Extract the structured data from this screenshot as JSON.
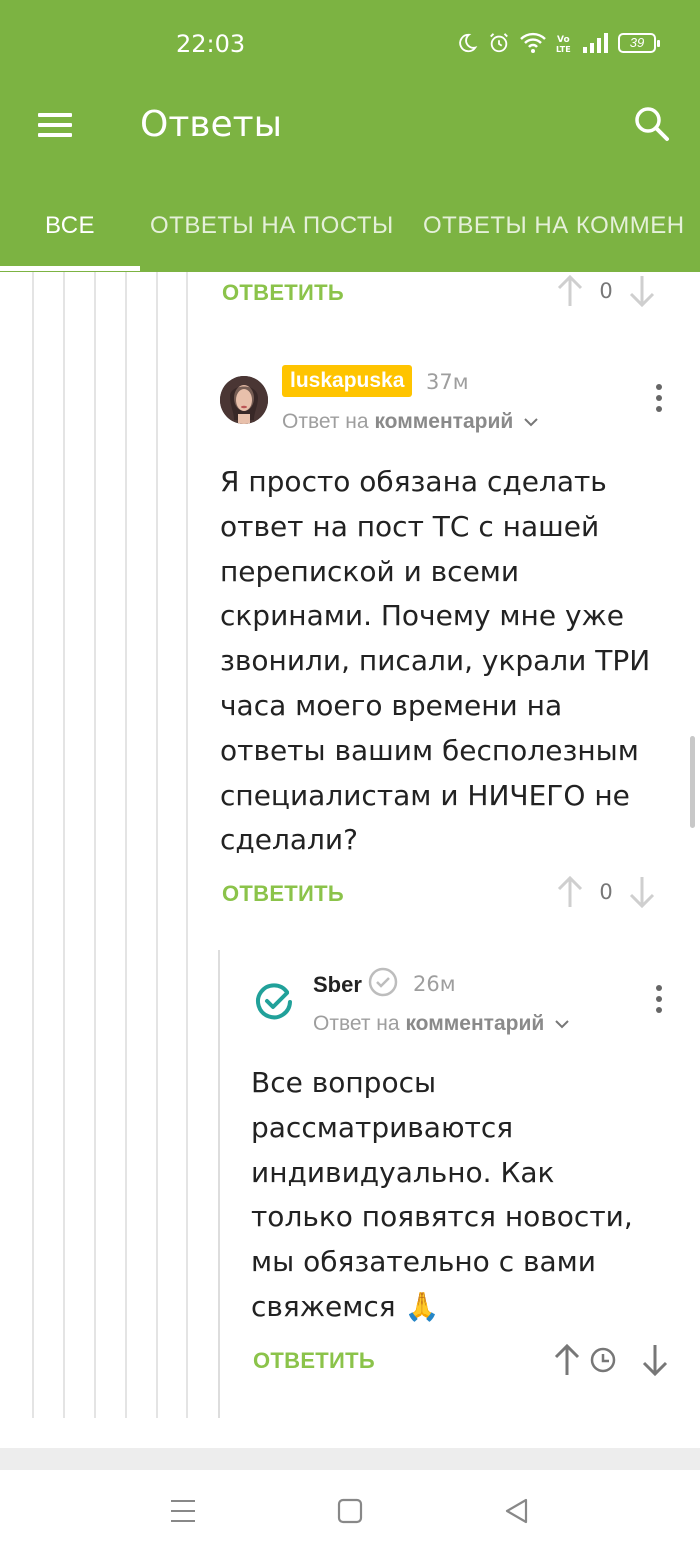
{
  "status_bar": {
    "time": "22:03",
    "battery": "39",
    "icons": [
      "moon-icon",
      "alarm-icon",
      "wifi-icon",
      "volte-icon",
      "signal-icon",
      "battery-icon"
    ]
  },
  "toolbar": {
    "title": "Ответы",
    "menu_icon": "hamburger-menu-icon",
    "search_icon": "search-icon"
  },
  "tabs": [
    {
      "label": "ВСЕ",
      "active": true
    },
    {
      "label": "ОТВЕТЫ НА ПОСТЫ",
      "active": false
    },
    {
      "label": "ОТВЕТЫ НА КОММЕН",
      "active": false
    }
  ],
  "colors": {
    "header_bg": "#7cb342",
    "accent_green": "#8bc34a",
    "username_badge": "#ffc400"
  },
  "comments": {
    "top_actions": {
      "reply_label": "ОТВЕТИТЬ",
      "votes": "0"
    },
    "first": {
      "username": "luskapuska",
      "time": "37м",
      "reply_prefix": "Ответ на",
      "reply_target": "комментарий",
      "text": "Я просто обязана сделать ответ на пост ТС с нашей перепиской и всеми скринами. Почему мне уже звонили, писали, украли ТРИ часа моего времени на ответы вашим бесполезным специалистам и НИЧЕГО не сделали?",
      "reply_label": "ОТВЕТИТЬ",
      "votes": "0"
    },
    "second": {
      "username": "Sber",
      "verified_icon": "verified-check-icon",
      "time": "26м",
      "reply_prefix": "Ответ на",
      "reply_target": "комментарий",
      "text": "Все вопросы рассматриваются индивидуально. Как только появятся новости, мы обязательно с вами свяжемся 🙏",
      "reply_label": "ОТВЕТИТЬ",
      "vote_status_icon": "clock-icon"
    }
  },
  "navbar": {
    "icons": [
      "recents-icon",
      "home-icon",
      "back-icon"
    ]
  }
}
